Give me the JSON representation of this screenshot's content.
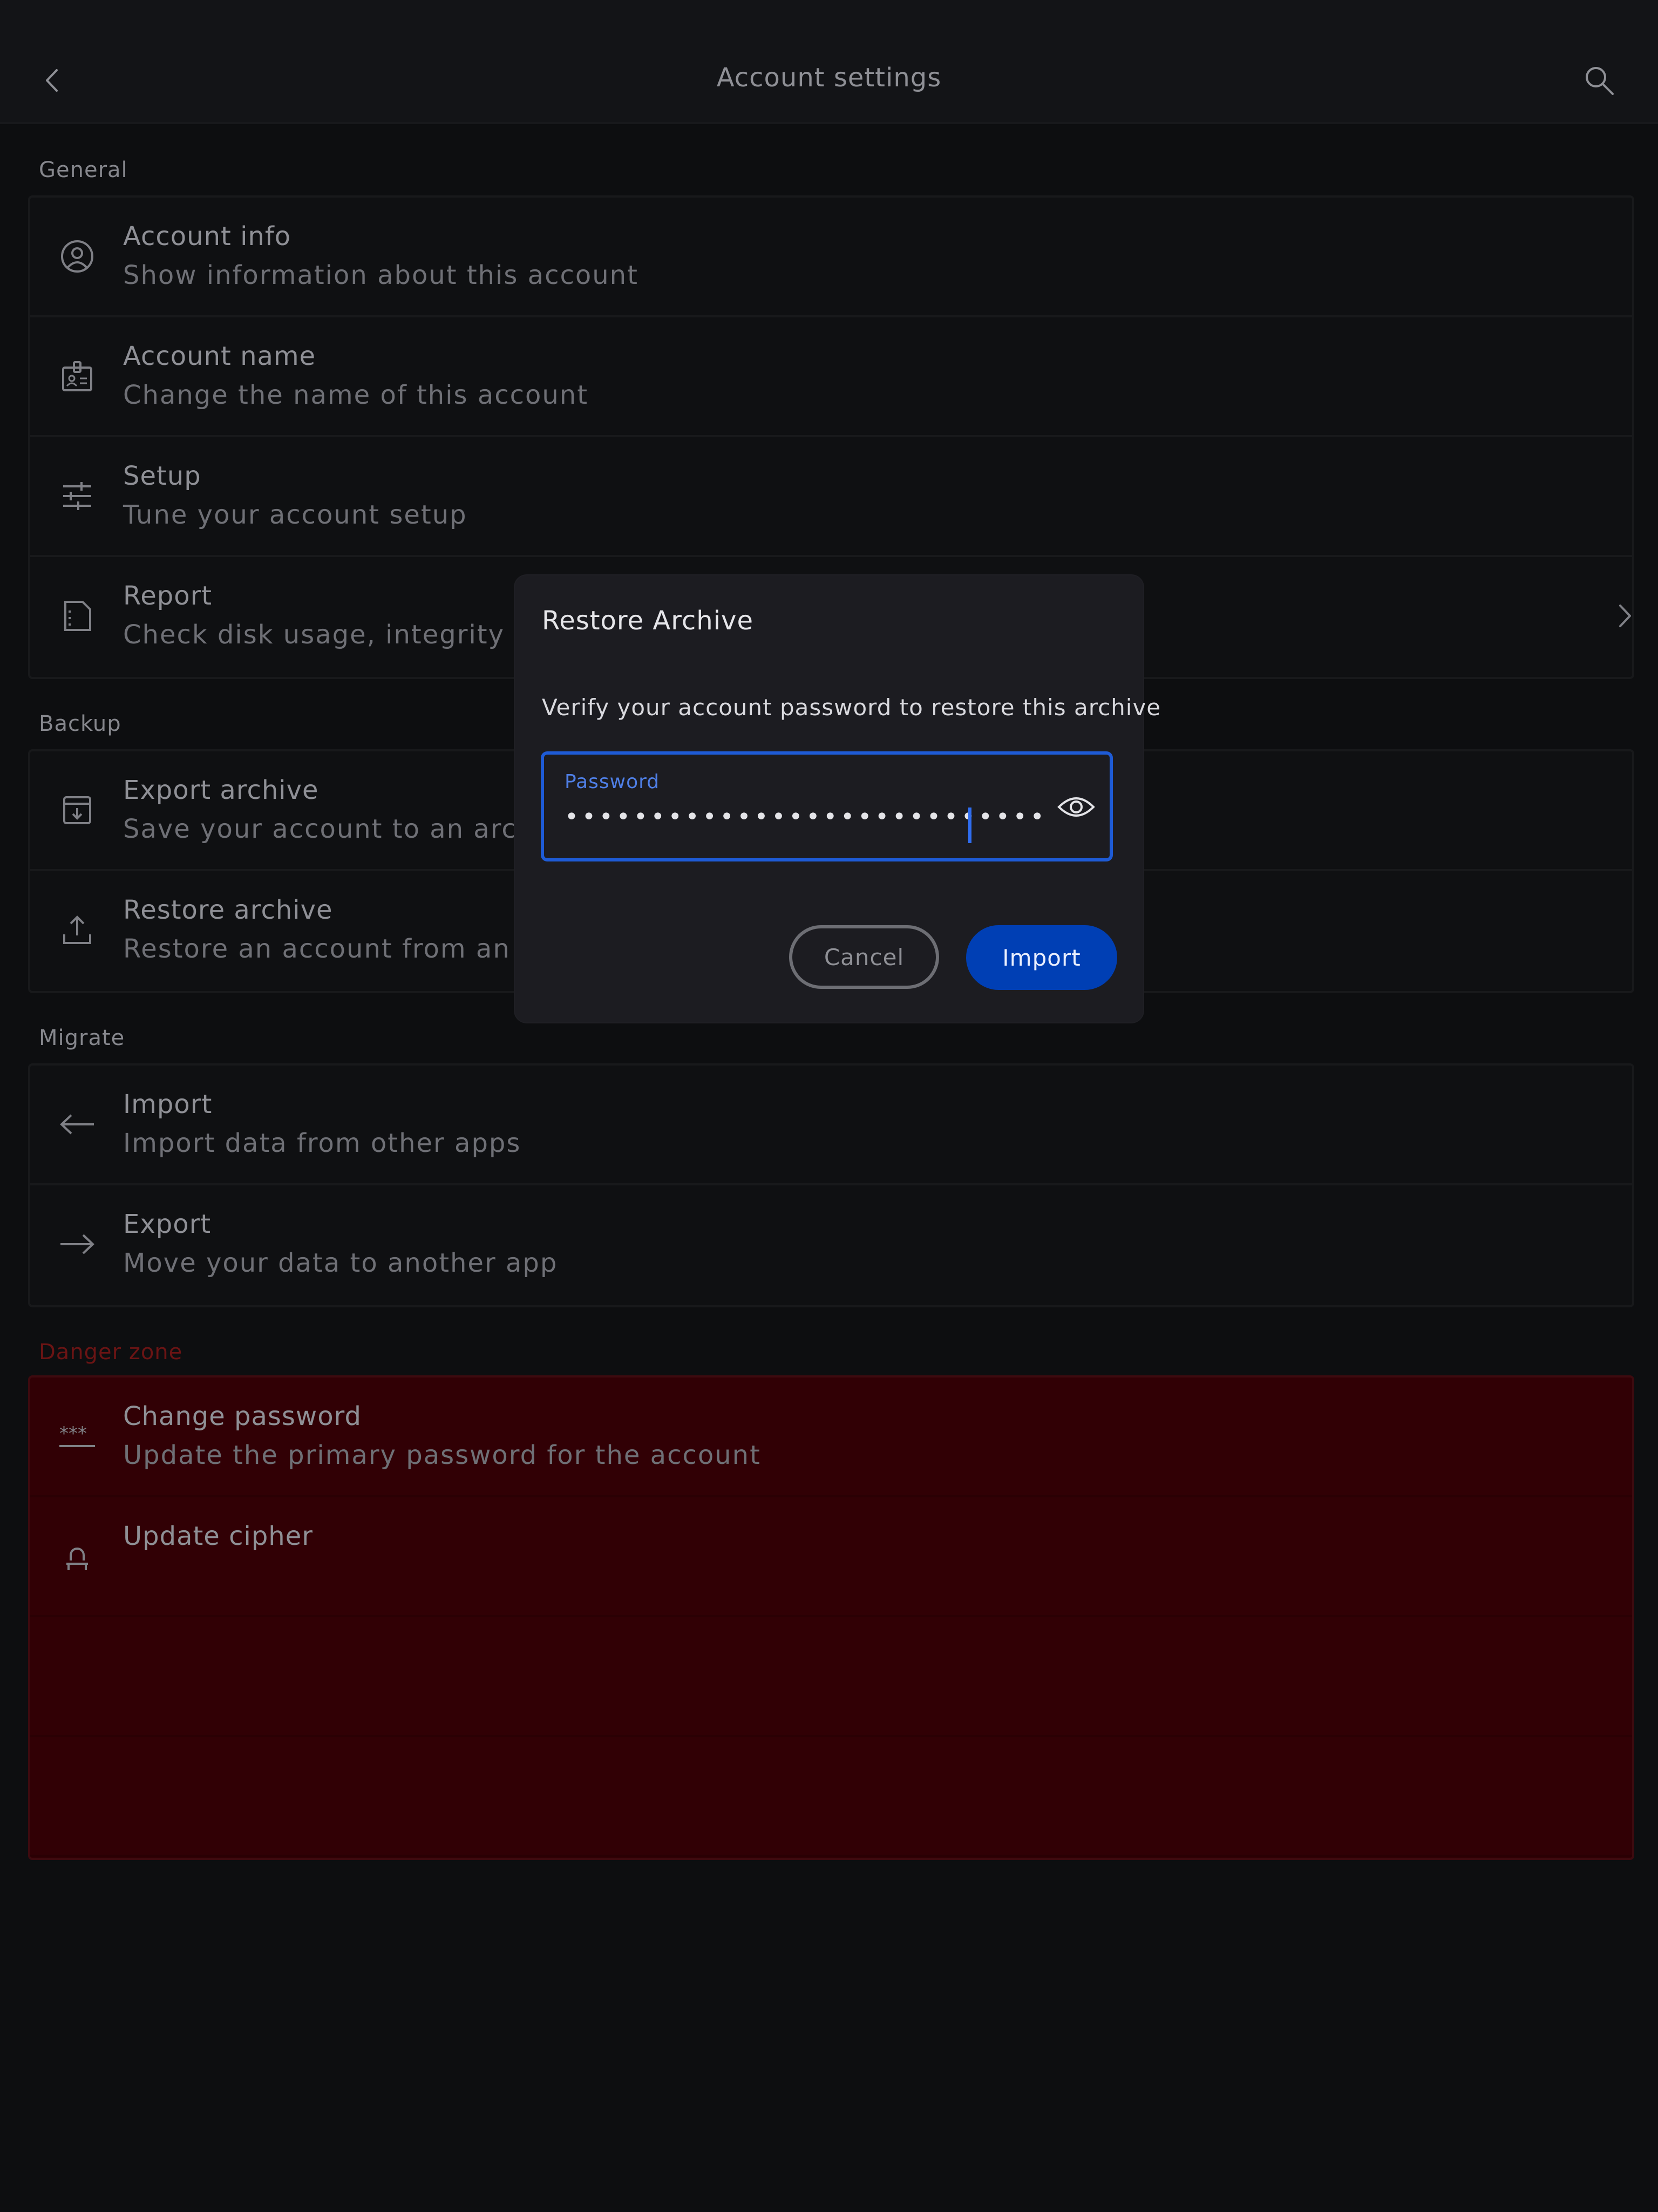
{
  "header": {
    "title": "Account settings",
    "back_icon": "chevron-left-icon",
    "search_icon": "search-icon"
  },
  "sections": {
    "general": {
      "label": "General",
      "items": [
        {
          "title": "Account info",
          "subtitle": "Show information about this account",
          "icon": "user-circle-icon"
        },
        {
          "title": "Account name",
          "subtitle": "Change the name of this account",
          "icon": "badge-icon"
        },
        {
          "title": "Setup",
          "subtitle": "Tune your account setup",
          "icon": "sliders-icon"
        },
        {
          "title": "Report",
          "subtitle": "Check disk usage, integrity and",
          "icon": "document-icon"
        }
      ]
    },
    "backup": {
      "label": "Backup",
      "items": [
        {
          "title": "Export archive",
          "subtitle": "Save your account to an archive",
          "icon": "archive-download-icon"
        },
        {
          "title": "Restore archive",
          "subtitle": "Restore an account from an ar",
          "icon": "upload-icon"
        }
      ]
    },
    "migrate": {
      "label": "Migrate",
      "items": [
        {
          "title": "Import",
          "subtitle": "Import data from other apps",
          "icon": "arrow-left-icon"
        },
        {
          "title": "Export",
          "subtitle": "Move your data to another app",
          "icon": "arrow-right-icon"
        }
      ]
    },
    "danger": {
      "label": "Danger zone",
      "items": [
        {
          "title": "Change password",
          "subtitle": "Update the primary password for the account",
          "icon": "password-icon"
        },
        {
          "title": "Update cipher",
          "subtitle": "",
          "icon": "lock-icon"
        }
      ]
    }
  },
  "dialog": {
    "title": "Restore Archive",
    "message": "Verify your account password to restore this archive",
    "password": {
      "label": "Password",
      "value": "••••••••••••••••••••••••••••",
      "toggle_icon": "eye-icon"
    },
    "cancel_label": "Cancel",
    "import_label": "Import"
  },
  "colors": {
    "background": "#0d0e10",
    "dialog": "#1c1c21",
    "accent": "#003fb4",
    "focus": "#1e5bd6",
    "danger": "#310005",
    "danger_label": "#6b1414"
  }
}
